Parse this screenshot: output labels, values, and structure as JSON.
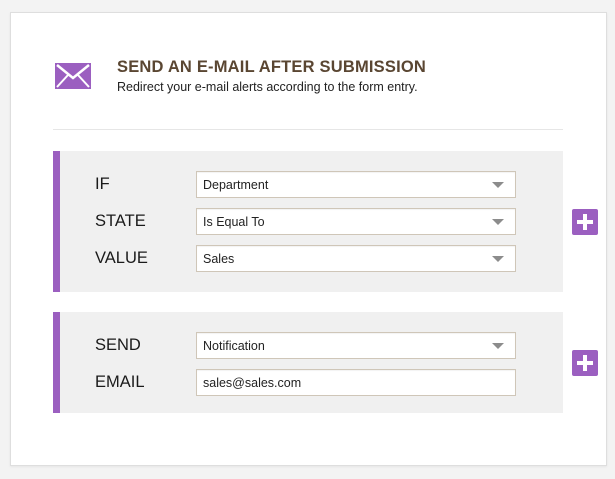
{
  "header": {
    "icon": "envelope-icon",
    "title": "SEND AN E-MAIL AFTER SUBMISSION",
    "subtitle": "Redirect your e-mail alerts according to the form entry."
  },
  "condition": {
    "if": {
      "label": "IF",
      "selected": "Department"
    },
    "state": {
      "label": "STATE",
      "selected": "Is Equal To"
    },
    "value": {
      "label": "VALUE",
      "selected": "Sales"
    },
    "add_icon": "plus-icon"
  },
  "action": {
    "send": {
      "label": "SEND",
      "selected": "Notification"
    },
    "email": {
      "label": "EMAIL",
      "value": "sales@sales.com"
    },
    "add_icon": "plus-icon"
  },
  "colors": {
    "accent": "#9b5fc0",
    "title": "#5a4632",
    "block_background": "#f0f0f0"
  }
}
